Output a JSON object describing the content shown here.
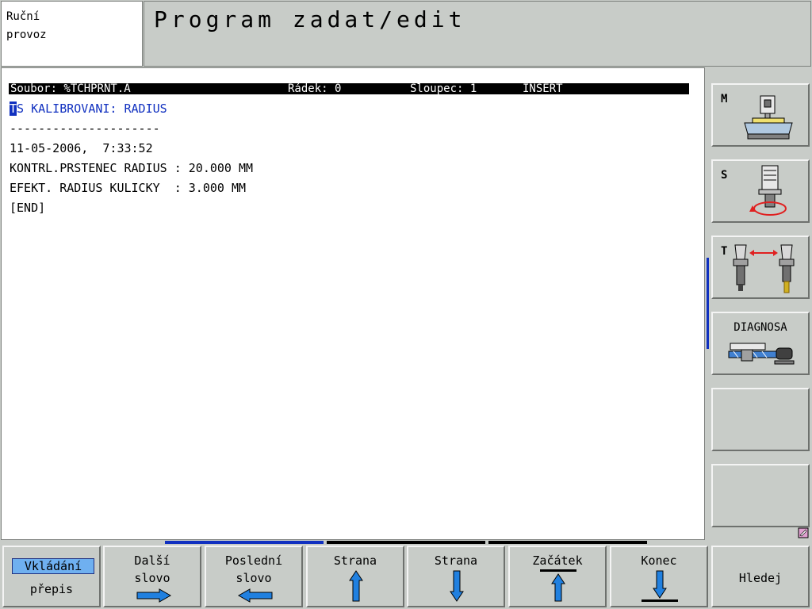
{
  "header": {
    "mode_line1": "Ruční",
    "mode_line2": "provoz",
    "title": "Program zadat/edit"
  },
  "editor": {
    "status": {
      "file": "Soubor: %TCHPRNT.A",
      "row": "Řádek: 0",
      "column": "Sloupec: 1",
      "mode": "INSERT"
    },
    "cursor_char": "T",
    "line1_rest": "S KALIBROVANI: RADIUS",
    "lines": [
      "---------------------",
      "11-05-2006,  7:33:52",
      "KONTRL.PRSTENEC RADIUS : 20.000 MM",
      "EFEKT. RADIUS KULICKY  : 3.000 MM",
      "[END]"
    ]
  },
  "side_keys": {
    "m_label": "M",
    "s_label": "S",
    "t_label": "T",
    "diagnosa_label": "DIAGNOSA"
  },
  "bottom_keys": {
    "insert_label": "Vkládání",
    "overwrite_label": "přepis",
    "next_word_l1": "Další",
    "next_word_l2": "slovo",
    "last_word_l1": "Poslední",
    "last_word_l2": "slovo",
    "page_up_label": "Strana",
    "page_down_label": "Strana",
    "begin_label": "Začátek",
    "end_label": "Konec",
    "find_label": "Hledej"
  },
  "colors": {
    "accent_blue": "#1030c0",
    "mode_highlight": "#6fb0f0",
    "arrow_blue": "#2080e0",
    "panel_gray": "#c8ccc8"
  }
}
